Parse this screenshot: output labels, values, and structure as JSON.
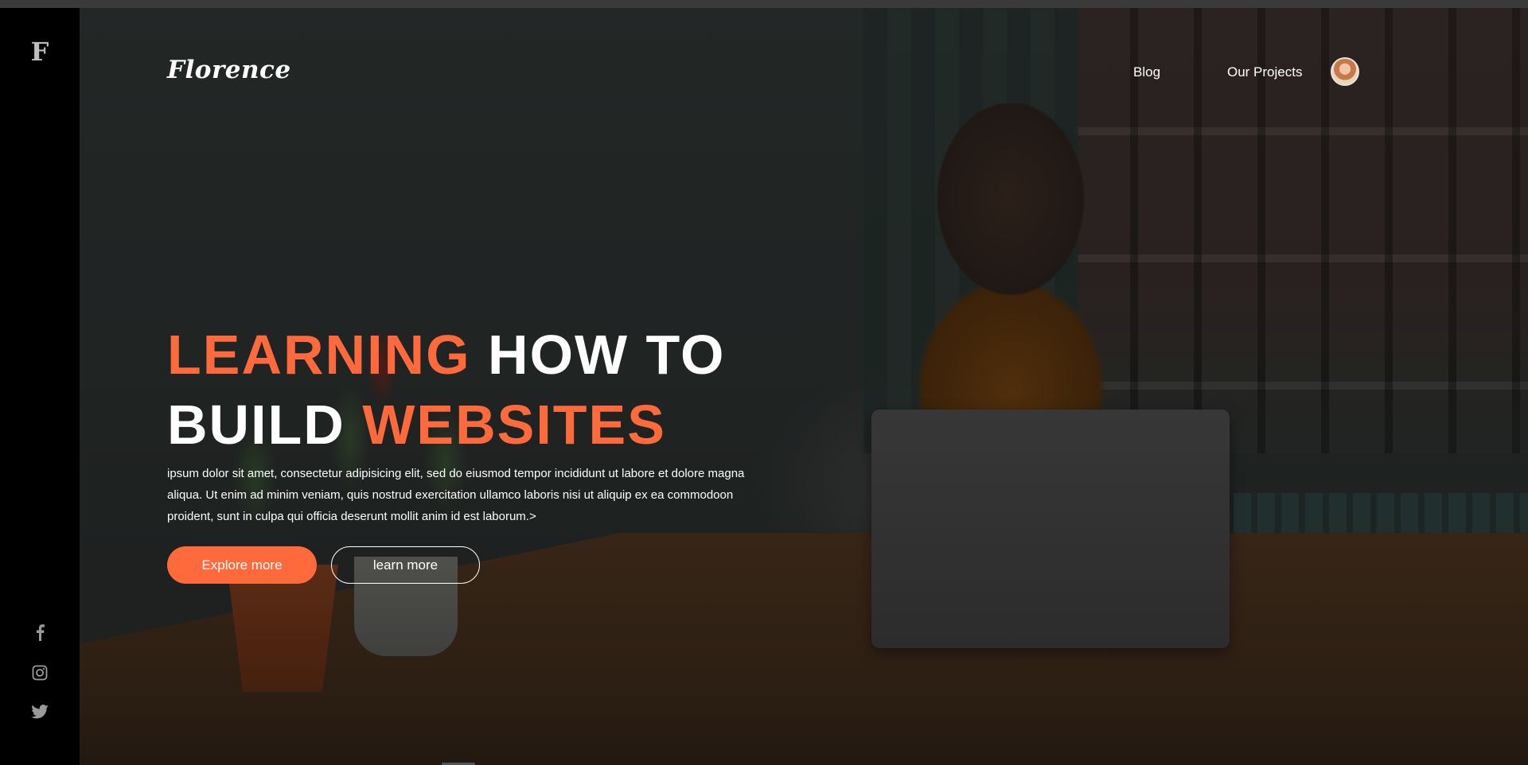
{
  "sidebar": {
    "logo_letter": "F",
    "social": [
      {
        "icon": "facebook-icon"
      },
      {
        "icon": "instagram-icon"
      },
      {
        "icon": "twitter-icon"
      }
    ]
  },
  "header": {
    "brand": "Florence",
    "nav": [
      "Blog",
      "Our Projects"
    ],
    "avatar": "avatar"
  },
  "hero": {
    "headline_line1_accent": "LEARNING",
    "headline_line1_rest": " HOW TO",
    "headline_line2_start": "BUILD ",
    "headline_line2_accent": "WEBSITES",
    "description": "ipsum dolor sit amet, consectetur adipisicing elit, sed do eiusmod tempor incididunt ut labore et dolore magna aliqua. Ut enim ad minim veniam, quis nostrud exercitation ullamco laboris nisi ut aliquip ex ea commodoon proident, sunt in culpa qui officia deserunt mollit anim id est laborum.>",
    "primary_button": "Explore more",
    "secondary_button": "learn more"
  },
  "colors": {
    "accent": "#ff6a3d",
    "sidebar_bg": "#000000",
    "text": "#ffffff"
  }
}
